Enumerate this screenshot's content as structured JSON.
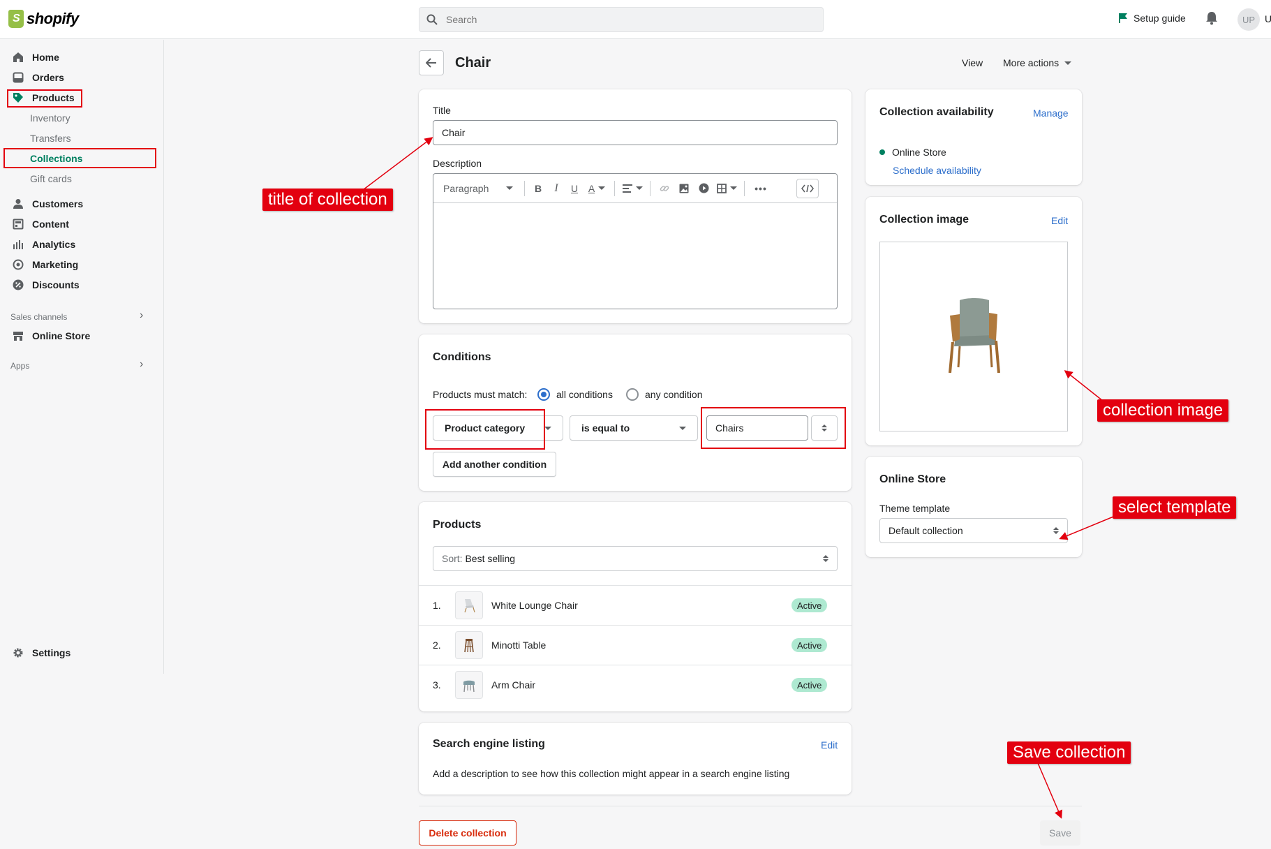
{
  "brand": {
    "name": "shopify",
    "primary_color": "#008060",
    "highlight_color": "#e3000f"
  },
  "topbar": {
    "search_placeholder": "Search",
    "setup_guide": "Setup guide",
    "avatar_initials": "UP",
    "user_initial": "U"
  },
  "sidebar": {
    "items": [
      {
        "label": "Home",
        "icon": "home-icon"
      },
      {
        "label": "Orders",
        "icon": "inbox-icon"
      },
      {
        "label": "Products",
        "icon": "tag-icon"
      },
      {
        "label": "Customers",
        "icon": "person-icon"
      },
      {
        "label": "Content",
        "icon": "content-icon"
      },
      {
        "label": "Analytics",
        "icon": "bar-chart-icon"
      },
      {
        "label": "Marketing",
        "icon": "target-icon"
      },
      {
        "label": "Discounts",
        "icon": "discount-icon"
      }
    ],
    "products_sub": [
      "Inventory",
      "Transfers",
      "Collections",
      "Gift cards"
    ],
    "sales_channels_label": "Sales channels",
    "online_store": "Online Store",
    "apps_label": "Apps",
    "settings": "Settings"
  },
  "page": {
    "title": "Chair",
    "view": "View",
    "more_actions": "More actions"
  },
  "title_card": {
    "title_label": "Title",
    "title_value": "Chair",
    "description_label": "Description",
    "format": "Paragraph"
  },
  "conditions": {
    "heading": "Conditions",
    "match_label": "Products must match:",
    "option_all": "all conditions",
    "option_any": "any condition",
    "selected": "all conditions",
    "field": "Product category",
    "operator": "is equal to",
    "value": "Chairs",
    "add_button": "Add another condition"
  },
  "products": {
    "heading": "Products",
    "sort_label": "Sort:",
    "sort_value": "Best selling",
    "rows": [
      {
        "num": "1.",
        "name": "White Lounge Chair",
        "status": "Active"
      },
      {
        "num": "2.",
        "name": "Minotti Table",
        "status": "Active"
      },
      {
        "num": "3.",
        "name": "Arm Chair",
        "status": "Active"
      }
    ]
  },
  "seo": {
    "heading": "Search engine listing",
    "edit": "Edit",
    "text": "Add a description to see how this collection might appear in a search engine listing"
  },
  "availability": {
    "heading": "Collection availability",
    "manage": "Manage",
    "channel": "Online Store",
    "schedule": "Schedule availability"
  },
  "collection_image": {
    "heading": "Collection image",
    "edit": "Edit"
  },
  "online_store_card": {
    "heading": "Online Store",
    "template_label": "Theme template",
    "template_value": "Default collection"
  },
  "footer": {
    "delete": "Delete collection",
    "save": "Save"
  },
  "annotations": {
    "title": "title of collection",
    "image": "collection image",
    "template": "select template",
    "save": "Save collection"
  }
}
